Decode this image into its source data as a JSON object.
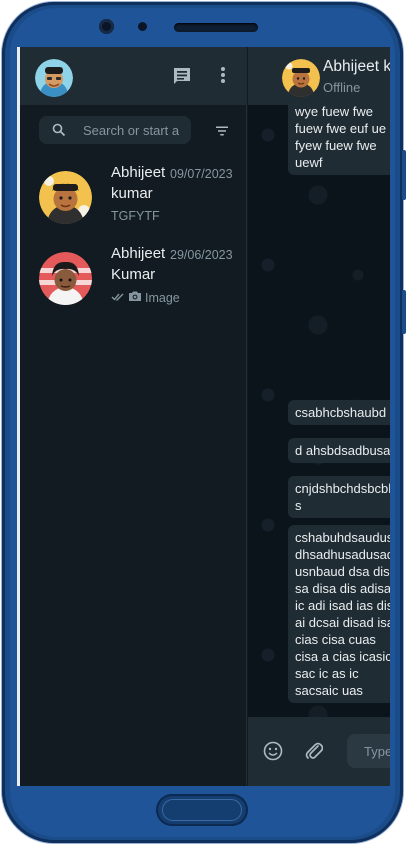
{
  "left_panel": {
    "search": {
      "placeholder": "Search or start a new chat"
    },
    "chats": [
      {
        "name": "Abhijeet kumar",
        "date": "09/07/2023",
        "preview": "TGFYTF"
      },
      {
        "name": "Abhijeet Kumar",
        "date": "29/06/2023",
        "preview": "Image"
      }
    ]
  },
  "conversation": {
    "contact_name": "Abhijeet kumar",
    "status": "Offline",
    "messages": [
      "wye fuew fwe fuew fwe euf ue fyew fuew fwe uewf",
      "csabhcbshaubd",
      "d ahsbdsadbusad",
      "cnjdshbchdsbcbhds s",
      "cshabuhdsaudusad dhsadhusadusad usnbaud dsa disa sa disa dis adisa ic adi isad ias dis ai dcsai disad isa cias cisa cuas cisa a cias icasic sac ic as ic sacsaic uas"
    ],
    "composer_placeholder": "Type a message"
  },
  "colors": {
    "panel_bg": "#111b21",
    "header_bg": "#202c33",
    "chat_bg": "#0b141a",
    "bubble_bg": "#202c33",
    "phone_frame": "#1b4c8a"
  }
}
